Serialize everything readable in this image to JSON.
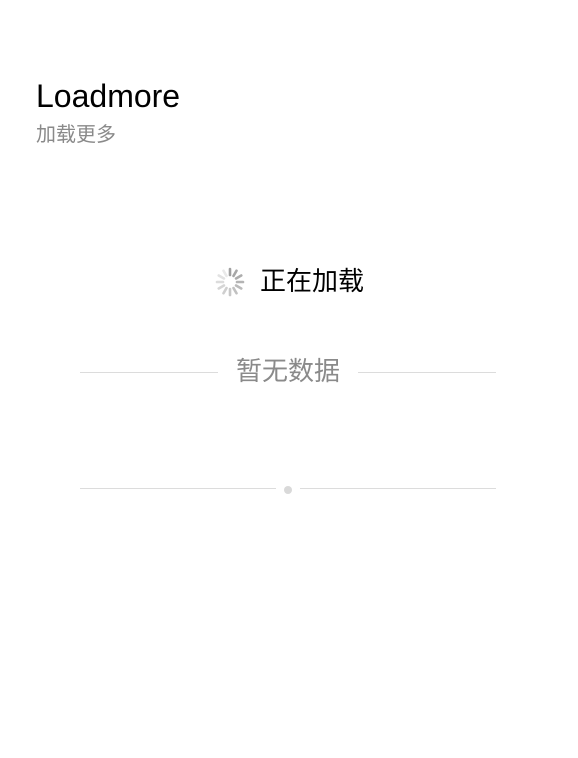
{
  "header": {
    "title": "Loadmore",
    "subtitle": "加载更多"
  },
  "loading": {
    "icon": "spinner-icon",
    "text": "正在加载"
  },
  "nodata": {
    "text": "暂无数据"
  },
  "end_divider": {
    "icon": "dot-icon"
  },
  "colors": {
    "title": "#000000",
    "muted_text": "#8a8a8a",
    "divider_line": "#dcdcdc",
    "spinner": "#a0a0a0"
  }
}
